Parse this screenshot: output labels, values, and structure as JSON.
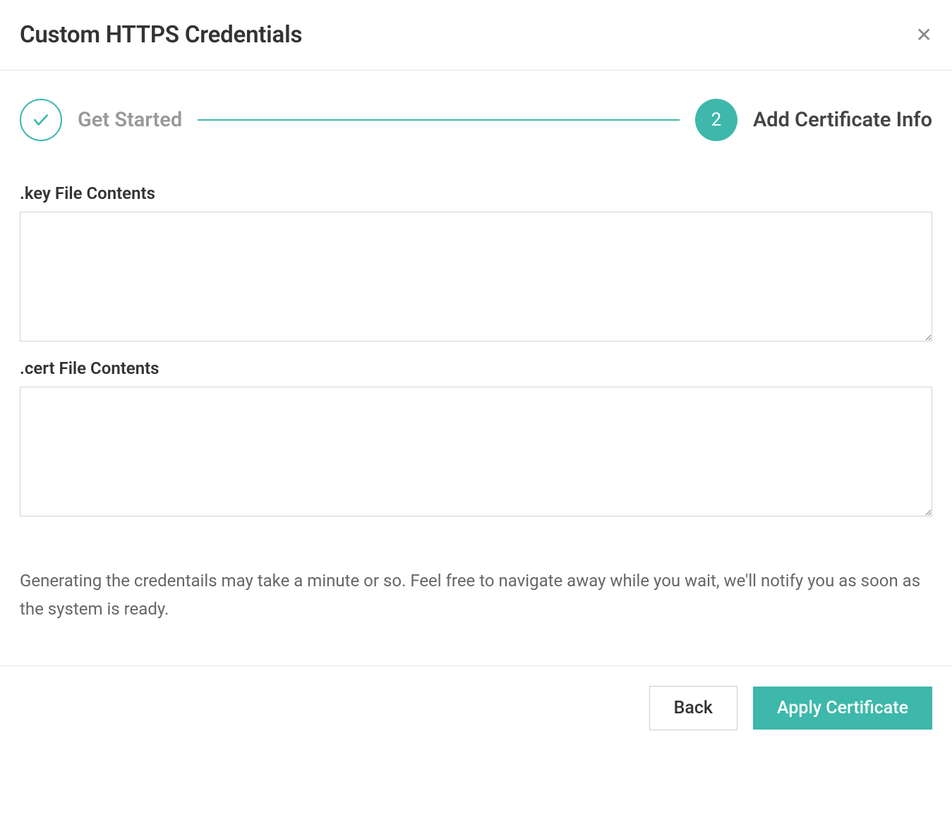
{
  "header": {
    "title": "Custom HTTPS Credentials"
  },
  "stepper": {
    "step1": {
      "label": "Get Started"
    },
    "step2": {
      "number": "2",
      "label": "Add Certificate Info"
    }
  },
  "form": {
    "key": {
      "label": ".key File Contents",
      "value": ""
    },
    "cert": {
      "label": ".cert File Contents",
      "value": ""
    },
    "hint": "Generating the credentails may take a minute or so. Feel free to navigate away while you wait, we'll notify you as soon as the system is ready."
  },
  "footer": {
    "back": "Back",
    "apply": "Apply Certificate"
  }
}
